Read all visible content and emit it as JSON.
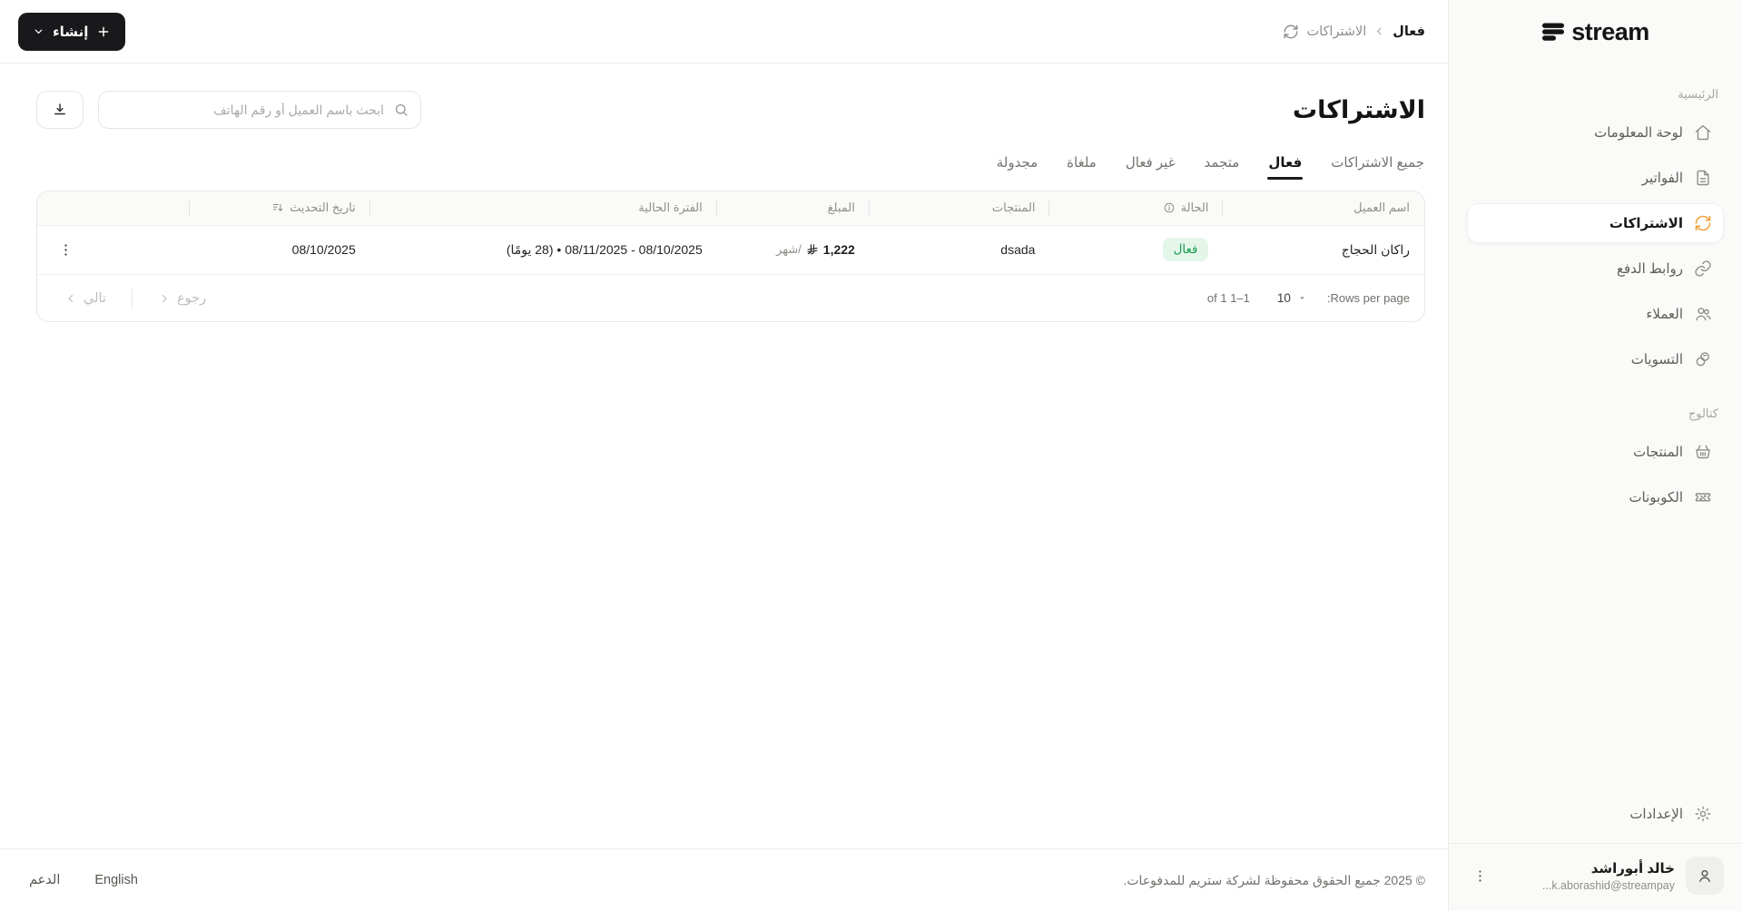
{
  "brand": {
    "name": "stream"
  },
  "topbar": {
    "breadcrumb": {
      "root": "الاشتراكات",
      "current": "فعال"
    },
    "create_label": "إنشاء"
  },
  "sidebar": {
    "sections": [
      {
        "label": "الرئيسية",
        "items": [
          {
            "label": "لوحة المعلومات",
            "icon": "home-icon",
            "active": false
          },
          {
            "label": "الفواتير",
            "icon": "invoice-icon",
            "active": false
          },
          {
            "label": "الاشتراكات",
            "icon": "sync-icon",
            "active": true
          },
          {
            "label": "روابط الدفع",
            "icon": "link-icon",
            "active": false
          },
          {
            "label": "العملاء",
            "icon": "users-icon",
            "active": false
          },
          {
            "label": "التسويات",
            "icon": "coins-icon",
            "active": false
          }
        ]
      },
      {
        "label": "كتالوج",
        "items": [
          {
            "label": "المنتجات",
            "icon": "basket-icon",
            "active": false
          },
          {
            "label": "الكوبونات",
            "icon": "coupon-icon",
            "active": false
          }
        ]
      }
    ],
    "settings_label": "الإعدادات",
    "user": {
      "name": "خالد أبوراشد",
      "email_display": "...k.aborashid@streampay"
    }
  },
  "page": {
    "title": "الاشتراكات",
    "search_placeholder": "ابحث باسم العميل أو رقم الهاتف",
    "tabs": [
      {
        "label": "جميع الاشتراكات",
        "active": false
      },
      {
        "label": "فعال",
        "active": true
      },
      {
        "label": "متجمد",
        "active": false
      },
      {
        "label": "غير فعال",
        "active": false
      },
      {
        "label": "ملغاة",
        "active": false
      },
      {
        "label": "مجدولة",
        "active": false
      }
    ],
    "table": {
      "columns": [
        "اسم العميل",
        "الحالة",
        "المنتجات",
        "المبلغ",
        "الفترة الحالية",
        "تاريخ التحديث"
      ],
      "rows": [
        {
          "customer": "راكان الحجاج",
          "status": "فعال",
          "products": "dsada",
          "amount": "1,222",
          "amount_currency": "SAR",
          "amount_period": "/شهر",
          "current_period": "08/10/2025 - 08/11/2025 • (28 يومًا)",
          "updated_at": "08/10/2025"
        }
      ],
      "pagination": {
        "rows_per_page_label": "Rows per page:",
        "rows_per_page_value": "10",
        "displayed_rows": "1–1 of 1",
        "prev_label": "رجوع",
        "next_label": "تالي"
      }
    }
  },
  "footer": {
    "copyright": "© 2025 جميع الحقوق محفوظة لشركة ستريم للمدفوعات.",
    "language_label": "English",
    "support_label": "الدعم"
  },
  "colors": {
    "accent_amber": "#F2A33C",
    "badge_bg": "#E4F6EA",
    "badge_text": "#1D9E55",
    "primary_button_bg": "#19191C",
    "sidebar_bg": "#FAFAF8"
  }
}
